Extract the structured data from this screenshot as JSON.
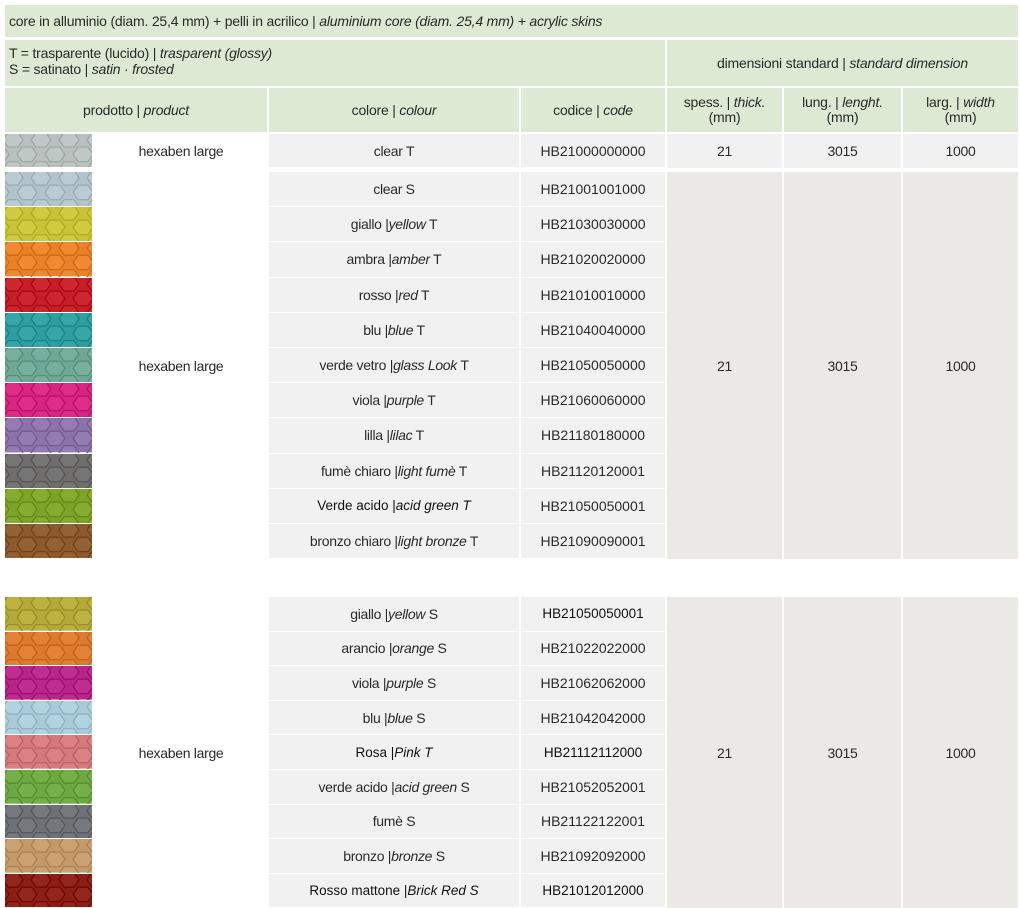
{
  "header": {
    "title_part1": "core in alluminio (diam. 25,4 mm) + pelli in acrilico | ",
    "title_part2": "aluminium core (diam. 25,4 mm) + acrylic skins",
    "legend_t_part1": "T = trasparente (lucido) | ",
    "legend_t_part2": "trasparent (glossy)",
    "legend_s_part1": "S = satinato | ",
    "legend_s_part2": "satin · frosted",
    "dim_part1": "dimensioni standard | ",
    "dim_part2": "standard dimension",
    "col_product_1": "prodotto | ",
    "col_product_2": "product",
    "col_colour_1": "colore | ",
    "col_colour_2": "colour",
    "col_code_1": "codice | ",
    "col_code_2": "code",
    "col_thick_1": "spess. | ",
    "col_thick_2": "thick.",
    "col_thick_3": "(mm)",
    "col_length_1": "lung. |  ",
    "col_length_2": "lenght.",
    "col_length_3": "(mm)",
    "col_width_1": "larg. | ",
    "col_width_2": "width",
    "col_width_3": "(mm)"
  },
  "groups": [
    {
      "product": "hexaben large",
      "thick": "21",
      "length": "3015",
      "width": "1000",
      "rows": [
        {
          "it": "",
          "plain": "clear T",
          "suffix": "",
          "code": "HB21000000000",
          "swatch": "#b9c0bd",
          "alt": false
        }
      ]
    },
    {
      "product": "hexaben large",
      "thick": "21",
      "length": "3015",
      "width": "1000",
      "rows": [
        {
          "plain": "clear S",
          "it": "",
          "suffix": "",
          "code": "HB21001001000",
          "swatch": "#b3c3cc",
          "alt": false
        },
        {
          "plain": "giallo | ",
          "it": "yellow",
          "suffix": " T",
          "code": "HB21030030000",
          "swatch": "#c8c43a",
          "alt": false
        },
        {
          "plain": "ambra | ",
          "it": "amber",
          "suffix": " T",
          "code": "HB21020020000",
          "swatch": "#e8822a",
          "alt": false
        },
        {
          "plain": "rosso | ",
          "it": "red",
          "suffix": " T",
          "code": "HB21010010000",
          "swatch": "#c5202a",
          "alt": false
        },
        {
          "plain": "blu | ",
          "it": "blue",
          "suffix": " T",
          "code": "HB21040040000",
          "swatch": "#2e9ea0",
          "alt": false
        },
        {
          "plain": "verde vetro | ",
          "it": "glass Look",
          "suffix": " T",
          "code": "HB21050050000",
          "swatch": "#6fa895",
          "alt": false
        },
        {
          "plain": "viola | ",
          "it": "purple",
          "suffix": " T",
          "code": "HB21060060000",
          "swatch": "#d62682",
          "alt": false
        },
        {
          "plain": "lilla | ",
          "it": "lilac",
          "suffix": " T",
          "code": "HB21180180000",
          "swatch": "#8c73a9",
          "alt": false
        },
        {
          "plain": "fumè chiaro | ",
          "it": "light fumè",
          "suffix": " T",
          "code": "HB21120120001",
          "swatch": "#6f6e6d",
          "alt": false
        },
        {
          "plain": "Verde acido | ",
          "it": "acid green T",
          "suffix": "",
          "code": "HB21050050001",
          "swatch": "#7ea32a",
          "alt": true
        },
        {
          "plain": "bronzo chiaro | ",
          "it": "light bronze",
          "suffix": " T",
          "code": "HB21090090001",
          "swatch": "#8b5a2e",
          "alt": false
        }
      ]
    },
    {
      "product": "hexaben large",
      "thick": "21",
      "length": "3015",
      "width": "1000",
      "rows": [
        {
          "plain": "giallo | ",
          "it": "yellow",
          "suffix": " S",
          "code": "HB21050050001",
          "swatch": "#b4a93a",
          "alt": false,
          "codealt": true
        },
        {
          "plain": "arancio | ",
          "it": "orange",
          "suffix": " S",
          "code": "HB21022022000",
          "swatch": "#dc7a30",
          "alt": false
        },
        {
          "plain": "viola | ",
          "it": "purple",
          "suffix": " S",
          "code": "HB21062062000",
          "swatch": "#b8268a",
          "alt": false
        },
        {
          "plain": "blu | ",
          "it": "blue",
          "suffix": " S",
          "code": "HB21042042000",
          "swatch": "#a9cbd9",
          "alt": false
        },
        {
          "plain": "Rosa | ",
          "it": "Pink T",
          "suffix": "",
          "code": "HB21112112000",
          "swatch": "#d47a7c",
          "alt": true,
          "codealt": true
        },
        {
          "plain": "verde acido | ",
          "it": "acid green",
          "suffix": " S",
          "code": "HB21052052001",
          "swatch": "#6ea843",
          "alt": false
        },
        {
          "plain": "fumè S",
          "it": "",
          "suffix": "",
          "code": "HB21122122001",
          "swatch": "#6e7175",
          "alt": false
        },
        {
          "plain": "bronzo | ",
          "it": "bronze",
          "suffix": " S",
          "code": "HB21092092000",
          "swatch": "#c59a6a",
          "alt": false
        },
        {
          "plain": "Rosso mattone  | ",
          "it": "Brick Red S",
          "suffix": "",
          "code": "HB21012012000",
          "swatch": "#8a1f14",
          "alt": true,
          "codealt": true
        }
      ]
    }
  ]
}
